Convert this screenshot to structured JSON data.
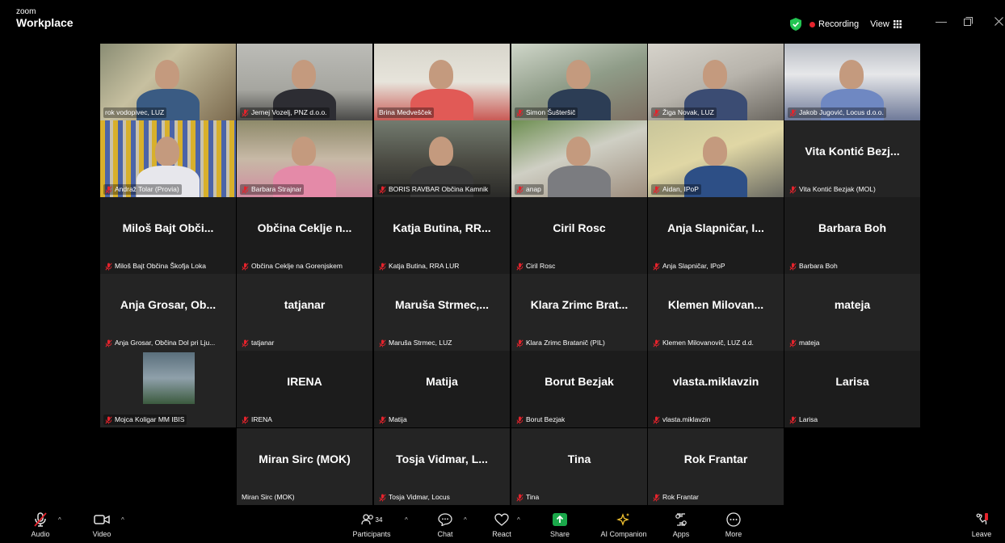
{
  "app": {
    "logo_top": "zoom",
    "logo_bottom": "Workplace"
  },
  "header": {
    "recording_label": "Recording",
    "view_label": "View",
    "accent": "#2dd45c",
    "rec_color": "#e5232c"
  },
  "tiles": [
    {
      "name": "rok vodopivec, LUZ",
      "muted": false
    },
    {
      "name": "Jernej Vozelj, PNZ d.o.o.",
      "muted": true
    },
    {
      "name": "Brina Medvešček",
      "muted": false,
      "active": true
    },
    {
      "name": "Simon Šušteršič",
      "muted": true
    },
    {
      "name": "Žiga Novak, LUZ",
      "muted": true
    },
    {
      "name": "Jakob Jugović, Locus d.o.o.",
      "muted": true
    },
    {
      "name": "Andraž Tolar (Provia)",
      "muted": true
    },
    {
      "name": "Barbara Strajnar",
      "muted": true
    },
    {
      "name": "BORIS RAVBAR Občina Kamnik",
      "muted": true
    },
    {
      "name": "anap",
      "muted": true
    },
    {
      "name": "Aidan, IPoP",
      "muted": true
    },
    {
      "name": "Vita Kontić Bezjak (MOL)",
      "display": "Vita Kontić Bezj...",
      "muted": true
    },
    {
      "name": "Miloš Bajt Občina Škofja Loka",
      "display": "Miloš Bajt Obči...",
      "muted": true
    },
    {
      "name": "Občina Ceklje na Gorenjskem",
      "display": "Občina Ceklje n...",
      "muted": true
    },
    {
      "name": "Katja Butina, RRA LUR",
      "display": "Katja Butina, RR...",
      "muted": true
    },
    {
      "name": "Ciril Rosc",
      "display": "Ciril Rosc",
      "muted": true
    },
    {
      "name": "Anja Slapničar, IPoP",
      "display": "Anja Slapničar, I...",
      "muted": true
    },
    {
      "name": "Barbara Boh",
      "display": "Barbara Boh",
      "muted": true
    },
    {
      "name": "Anja Grosar, Občina Dol pri Lju...",
      "display": "Anja Grosar, Ob...",
      "muted": true
    },
    {
      "name": "tatjanar",
      "display": "tatjanar",
      "muted": true
    },
    {
      "name": "Maruša Strmec, LUZ",
      "display": "Maruša Strmec,...",
      "muted": true
    },
    {
      "name": "Klara Zrimc Bratanič (PIL)",
      "display": "Klara Zrimc Brat...",
      "muted": true
    },
    {
      "name": "Klemen Milovanovič, LUZ d.d.",
      "display": "Klemen Milovan...",
      "muted": true
    },
    {
      "name": "mateja",
      "display": "mateja",
      "muted": true
    },
    {
      "name": "Mojca Koligar MM IBIS",
      "muted": true
    },
    {
      "name": "IRENA",
      "display": "IRENA",
      "muted": true
    },
    {
      "name": "Matija",
      "display": "Matija",
      "muted": true
    },
    {
      "name": "Borut Bezjak",
      "display": "Borut Bezjak",
      "muted": true
    },
    {
      "name": "vlasta.miklavzin",
      "display": "vlasta.miklavzin",
      "muted": true
    },
    {
      "name": "Larisa",
      "display": "Larisa",
      "muted": true
    },
    {
      "name": "Miran Sirc (MOK)",
      "display": "Miran Sirc (MOK)",
      "muted": false
    },
    {
      "name": "Tosja Vidmar, Locus",
      "display": "Tosja Vidmar, L...",
      "muted": true
    },
    {
      "name": "Tina",
      "display": "Tina",
      "muted": true
    },
    {
      "name": "Rok Frantar",
      "display": "Rok Frantar",
      "muted": true
    }
  ],
  "toolbar": {
    "audio": "Audio",
    "video": "Video",
    "participants": "Participants",
    "participants_count": "34",
    "chat": "Chat",
    "react": "React",
    "share": "Share",
    "ai_companion": "AI Companion",
    "apps": "Apps",
    "more": "More",
    "leave": "Leave"
  }
}
